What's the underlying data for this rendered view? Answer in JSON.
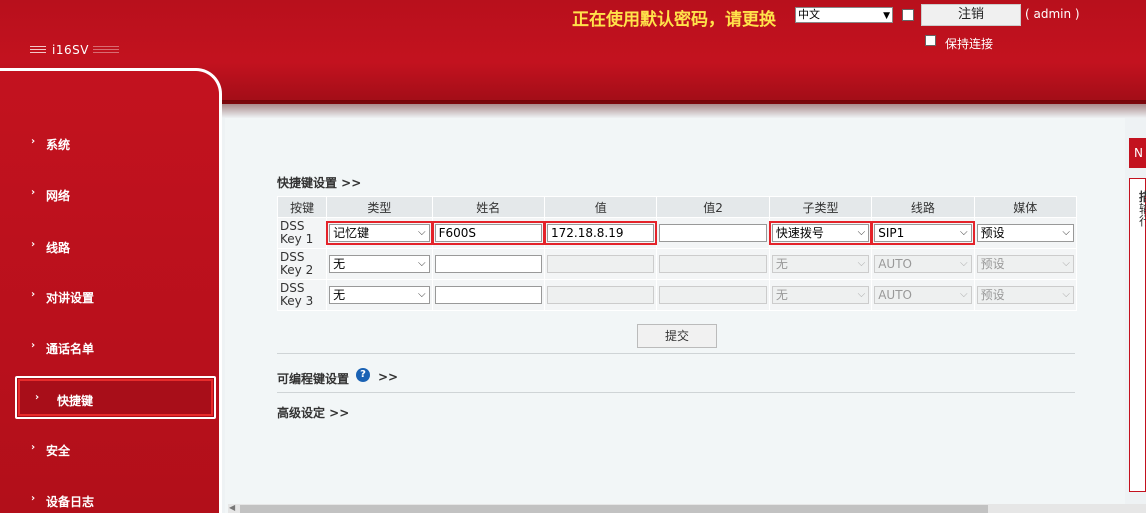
{
  "header": {
    "model": "i16SV",
    "warning": "正在使用默认密码，请更换",
    "language": "中文",
    "logout_label": "注销",
    "user": "( admin )",
    "keep_connected": "保持连接"
  },
  "sidebar": {
    "items": [
      {
        "label": "系统"
      },
      {
        "label": "网络"
      },
      {
        "label": "线路"
      },
      {
        "label": "对讲设置"
      },
      {
        "label": "通话名单"
      },
      {
        "label": "快捷键",
        "active": true
      },
      {
        "label": "安全"
      },
      {
        "label": "设备日志"
      }
    ]
  },
  "main": {
    "section_dss": "快捷键设置 >>",
    "section_programmable": "可编程键设置",
    "section_programmable_arrows": ">>",
    "section_advanced": "高级设定 >>",
    "submit_label": "提交",
    "right_tab": "N",
    "right_panel_text": [
      "描",
      "输",
      "行"
    ],
    "table": {
      "headers": [
        "按键",
        "类型",
        "姓名",
        "值",
        "值2",
        "子类型",
        "线路",
        "媒体"
      ],
      "rows": [
        {
          "key": "DSS Key 1",
          "type": "记忆键",
          "name": "F600S",
          "value": "172.18.8.19",
          "value2": "",
          "subtype": "快速拨号",
          "line": "SIP1",
          "media": "预设"
        },
        {
          "key": "DSS Key 2",
          "type": "无",
          "name": "",
          "value": "",
          "value2": "",
          "subtype": "无",
          "line": "AUTO",
          "media": "预设"
        },
        {
          "key": "DSS Key 3",
          "type": "无",
          "name": "",
          "value": "",
          "value2": "",
          "subtype": "无",
          "line": "AUTO",
          "media": "预设"
        }
      ]
    }
  },
  "icons": {
    "help": "question-circle-icon",
    "chevron": "chevron-right-icon",
    "dropdown": "chevron-down-icon"
  },
  "colors": {
    "brand_red": "#c3121f",
    "warning_yellow": "#ffe24a",
    "highlight_red": "#e4232a",
    "help_blue": "#1a62b4"
  }
}
